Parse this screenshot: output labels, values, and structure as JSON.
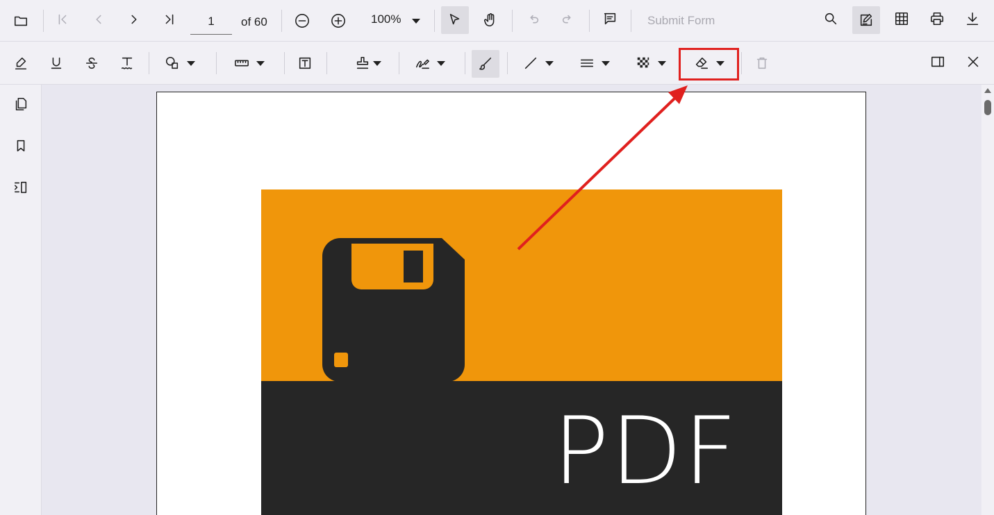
{
  "toolbar": {
    "page_number": "1",
    "page_total": "of 60",
    "zoom": "100%",
    "submit_form_label": "Submit Form"
  },
  "document": {
    "cover_text": "PDF"
  },
  "colors": {
    "cover_orange": "#f0960b",
    "cover_dark": "#262626",
    "highlight_red": "#e0201e"
  }
}
